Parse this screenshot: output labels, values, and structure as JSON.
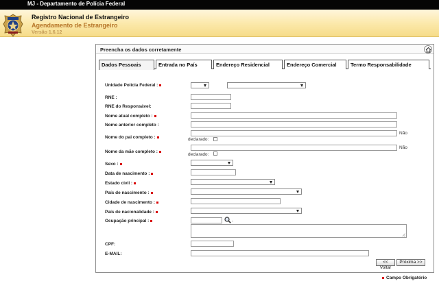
{
  "topbar": {
    "title": "MJ - Departamento de Polícia Federal"
  },
  "header": {
    "system": "Registro Nacional de Estrangeiro",
    "module": "Agendamento de Estrangeiro",
    "version": "Versão 1.6.12",
    "badge_text": "POLÍCIA FEDERAL"
  },
  "panel": {
    "title": "Preencha os dados corretamente"
  },
  "tabs": [
    {
      "label": "Dados Pessoais",
      "active": true
    },
    {
      "label": "Entrada no País"
    },
    {
      "label": "Endereço Residencial"
    },
    {
      "label": "Endereço Comercial"
    },
    {
      "label": "Termo Responsabilidade"
    }
  ],
  "form": {
    "unidade": "Unidade Polícia Federal :",
    "rne": "RNE :",
    "rne_resp": "RNE do Responsável:",
    "nome_atual": "Nome atual completo :",
    "nome_anterior": "Nome anterior completo :",
    "nome_pai": "Nome do pai completo :",
    "nome_mae": "Nome da mãe completo :",
    "nao": "Não",
    "declarado": "declarado:",
    "sexo": "Sexo :",
    "nascimento": "Data de nascimento :",
    "estado_civil": "Estado civil :",
    "pais_nasc": "País de nascimento :",
    "cidade_nasc": "Cidade de nascimento :",
    "pais_nac": "País de nacionalidade :",
    "ocupacao": "Ocupação principal :",
    "ocupacao_dash": "-",
    "cpf": "CPF:",
    "email": "E-MAIL:"
  },
  "buttons": {
    "prev": "<< Voltar",
    "next": "Próxima >>"
  },
  "legend": "Campo Obrigatório",
  "colors": {
    "required": "#d80000",
    "header_bg": "#fbe8a8",
    "version": "#c39a56",
    "module": "#b7762a"
  }
}
